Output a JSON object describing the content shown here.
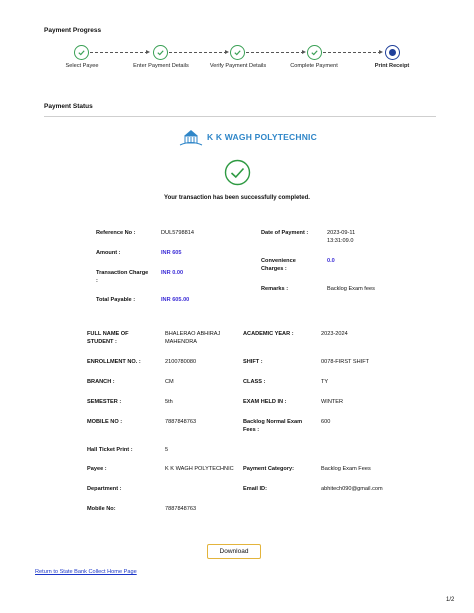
{
  "progress": {
    "title": "Payment Progress",
    "steps": [
      {
        "label": "Select Payee",
        "state": "done"
      },
      {
        "label": "Enter Payment Details",
        "state": "done"
      },
      {
        "label": "Verify Payment Details",
        "state": "done"
      },
      {
        "label": "Complete Payment",
        "state": "done"
      },
      {
        "label": "Print Receipt",
        "state": "current"
      }
    ]
  },
  "status": {
    "title": "Payment Status",
    "institute": "K K WAGH POLYTECHNIC",
    "message": "Your transaction has been successfully completed."
  },
  "transaction": {
    "ref_label": "Reference No :",
    "ref_value": "DUL5798814",
    "date_label": "Date of Payment :",
    "date_value_1": "2023-09-11",
    "date_value_2": "13:31:09.0",
    "amount_label": "Amount :",
    "amount_value": "INR 605",
    "conv_label_1": "Convenience",
    "conv_label_2": "Charges :",
    "conv_value": "0.0",
    "txn_charge_label_1": "Transaction Charge",
    "txn_charge_label_2": ":",
    "txn_charge_value": "INR 0.00",
    "remarks_label": "Remarks :",
    "remarks_value": "Backlog Exam fees",
    "total_label": "Total Payable :",
    "total_value": "INR 605.00"
  },
  "student": {
    "name_label_1": "FULL NAME OF",
    "name_label_2": "STUDENT :",
    "name_value_1": "BHALERAO ABHIRAJ",
    "name_value_2": "MAHENDRA",
    "year_label": "ACADEMIC YEAR :",
    "year_value": "2023-2024",
    "enroll_label": "ENROLLMENT NO. :",
    "enroll_value": "2100780080",
    "shift_label": "SHIFT :",
    "shift_value": "0078-FIRST SHIFT",
    "branch_label": "BRANCH :",
    "branch_value": "CM",
    "class_label": "CLASS :",
    "class_value": "TY",
    "semester_label": "SEMESTER :",
    "semester_value": "5th",
    "exam_label": "EXAM HELD IN :",
    "exam_value": "WINTER",
    "mobile_label": "MOBILE NO :",
    "mobile_value": "7887848763",
    "fees_label_1": "Backlog Normal Exam",
    "fees_label_2": "Fees :",
    "fees_value": "600",
    "hall_label": "Hall Ticket Print :",
    "hall_value": "5",
    "payee_label": "Payee :",
    "payee_value": "K K WAGH POLYTECHNIC",
    "category_label": "Payment Category:",
    "category_value": "Backlog Exam Fees",
    "dept_label": "Department :",
    "dept_value": "",
    "email_label": "Email ID:",
    "email_value": "abhitech090@gmail.com",
    "mobile2_label": "Mobile No:",
    "mobile2_value": "7887848763"
  },
  "actions": {
    "download_label": "Download",
    "home_link": "Return to State Bank Collect Home Page"
  },
  "page_number": "1/2",
  "colors": {
    "step_done": "#3aa055",
    "step_current": "#1f3f9a",
    "success_green": "#2e9a42",
    "amount_blue": "#3a2bd6",
    "button_border": "#e3b43c",
    "link_blue": "#1a35c8"
  }
}
